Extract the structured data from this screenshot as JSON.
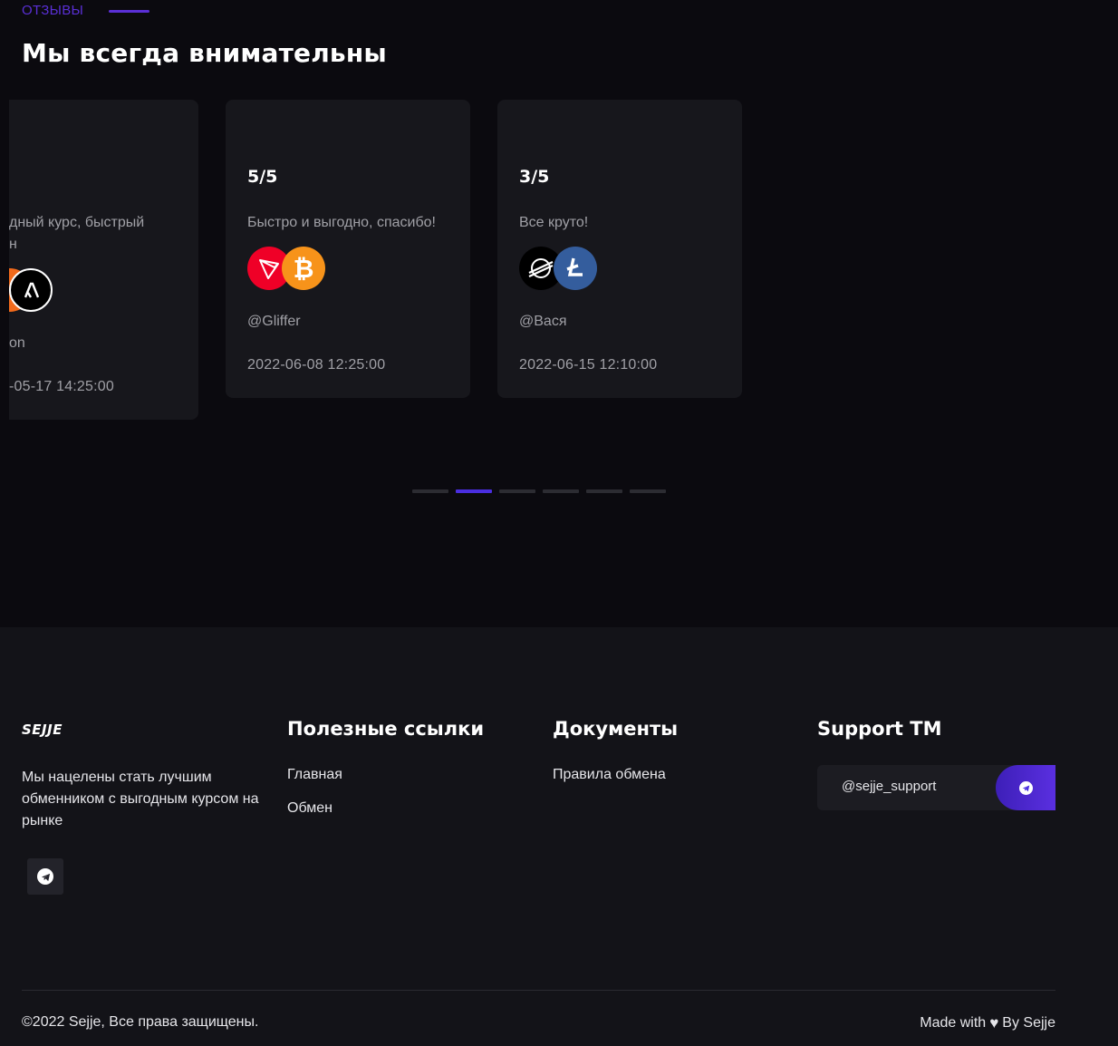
{
  "reviews": {
    "section_label": "ОТЗЫВЫ",
    "title": "Мы всегда внимательны",
    "cards": [
      {
        "text_line1": "дный курс, быстрый",
        "text_line2": "н",
        "author": "on",
        "date": "-05-17 14:25:00",
        "coins": [
          "partial-coin-icon",
          "algorand-icon"
        ]
      },
      {
        "rating": "5/5",
        "text": "Быстро и выгодно, спасибо!",
        "author": "@Gliffer",
        "date": "2022-06-08 12:25:00",
        "coins": [
          "tron-icon",
          "bitcoin-icon"
        ]
      },
      {
        "rating": "3/5",
        "text": "Все круто!",
        "author": "@Вася",
        "date": "2022-06-15 12:10:00",
        "coins": [
          "stellar-icon",
          "litecoin-icon"
        ]
      }
    ],
    "pagination": {
      "count": 6,
      "active_index": 1
    }
  },
  "footer": {
    "brand": "SEJJE",
    "description": "Мы нацелены стать лучшим обменником с выгодным курсом на рынке",
    "links_title": "Полезные ссылки",
    "links": [
      "Главная",
      "Обмен"
    ],
    "docs_title": "Документы",
    "docs": [
      "Правила обмена"
    ],
    "support_title": "Support TM",
    "support_handle": "@sejje_support",
    "copyright": "©2022 Sejje, Все права защищены.",
    "made_with_prefix": "Made with",
    "made_with_suffix": "By Sejje"
  },
  "colors": {
    "accent": "#5a2fd6",
    "active_dot": "#4a2ee0",
    "card_bg": "#17171c",
    "footer_bg": "#131318"
  }
}
